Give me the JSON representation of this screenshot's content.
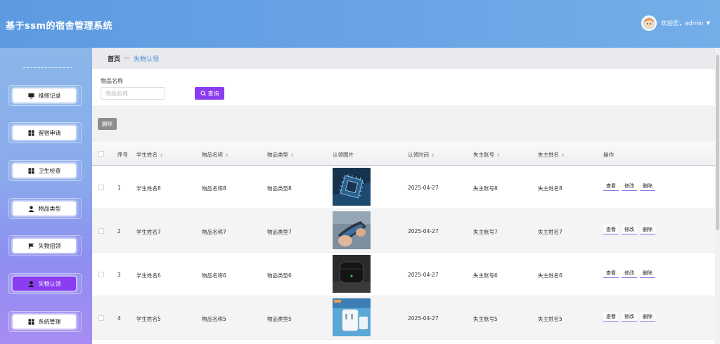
{
  "app": {
    "title": "基于ssm的宿舍管理系统"
  },
  "user": {
    "greeting": "欢迎您，admin"
  },
  "sidebar": {
    "items": [
      {
        "label": "维修记录",
        "icon": "monitor-icon"
      },
      {
        "label": "留宿申请",
        "icon": "grid-icon"
      },
      {
        "label": "卫生检查",
        "icon": "grid-icon"
      },
      {
        "label": "物品类型",
        "icon": "user-icon"
      },
      {
        "label": "失物招领",
        "icon": "flag-icon"
      },
      {
        "label": "失物认领",
        "icon": "user-icon",
        "active": true
      },
      {
        "label": "系统管理",
        "icon": "grid-icon"
      }
    ]
  },
  "breadcrumb": {
    "home": "首页",
    "separator": "—",
    "current": "失物认领"
  },
  "search": {
    "label": "物品名称",
    "placeholder": "物品名称",
    "value": "",
    "button": "查询"
  },
  "toolbar": {
    "delete_label": "删除"
  },
  "table": {
    "headers": {
      "index": "序号",
      "student_name": "学生姓名",
      "item_name": "物品名称",
      "item_type": "物品类型",
      "image": "认领图片",
      "claim_time": "认领时间",
      "owner_account": "失主账号",
      "owner_name": "失主姓名",
      "actions": "操作"
    },
    "rows": [
      {
        "index": "1",
        "student_name": "学生姓名8",
        "item_name": "物品名称8",
        "item_type": "物品类型8",
        "claim_time": "2025-04-27",
        "owner_account": "失主账号8",
        "owner_name": "失主姓名8",
        "image": "chip-photo"
      },
      {
        "index": "2",
        "student_name": "学生姓名7",
        "item_name": "物品名称7",
        "item_type": "物品类型7",
        "claim_time": "2025-04-27",
        "owner_account": "失主账号7",
        "owner_name": "失主姓名7",
        "image": "usb-stick-photo"
      },
      {
        "index": "3",
        "student_name": "学生姓名6",
        "item_name": "物品名称6",
        "item_type": "物品类型6",
        "claim_time": "2025-04-27",
        "owner_account": "失主账号6",
        "owner_name": "失主姓名6",
        "image": "earbuds-case-photo"
      },
      {
        "index": "4",
        "student_name": "学生姓名5",
        "item_name": "物品名称5",
        "item_type": "物品类型5",
        "claim_time": "2025-04-27",
        "owner_account": "失主账号5",
        "owner_name": "失主姓名5",
        "image": "charger-photo"
      }
    ],
    "actions": {
      "view": "查看",
      "edit": "修改",
      "delete": "删除"
    }
  },
  "colors": {
    "header": "#5d9ae0",
    "accent": "#8a3cf0",
    "breadcrumb_current": "#4a8ad8",
    "delete_gray": "#8d8d8d"
  }
}
